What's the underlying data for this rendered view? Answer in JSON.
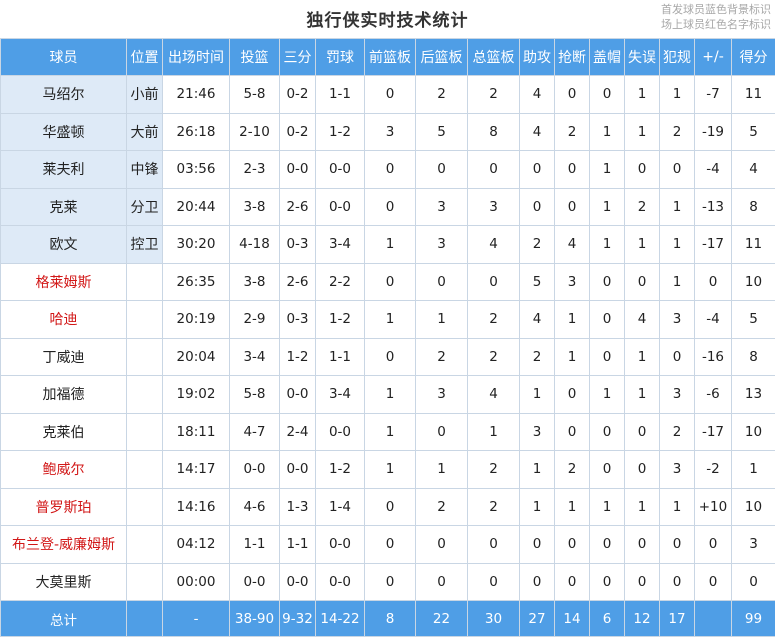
{
  "title": "独行侠实时技术统计",
  "legend": [
    "首发球员蓝色背景标识",
    "场上球员红色名字标识"
  ],
  "colors": {
    "header_bg": "#4f9ee6",
    "starter_bg": "#deeaf7",
    "on_court": "#d21818"
  },
  "headers": [
    "球员",
    "位置",
    "出场时间",
    "投篮",
    "三分",
    "罚球",
    "前篮板",
    "后篮板",
    "总篮板",
    "助攻",
    "抢断",
    "盖帽",
    "失误",
    "犯规",
    "+/-",
    "得分"
  ],
  "players": [
    {
      "name": "马绍尔",
      "pos": "小前",
      "min": "21:46",
      "fg": "5-8",
      "tp": "0-2",
      "ft": "1-1",
      "oreb": "0",
      "dreb": "2",
      "reb": "2",
      "ast": "4",
      "stl": "0",
      "blk": "0",
      "tov": "1",
      "pf": "1",
      "pm": "-7",
      "pts": "11",
      "starter": true,
      "oncourt": false
    },
    {
      "name": "华盛顿",
      "pos": "大前",
      "min": "26:18",
      "fg": "2-10",
      "tp": "0-2",
      "ft": "1-2",
      "oreb": "3",
      "dreb": "5",
      "reb": "8",
      "ast": "4",
      "stl": "2",
      "blk": "1",
      "tov": "1",
      "pf": "2",
      "pm": "-19",
      "pts": "5",
      "starter": true,
      "oncourt": false
    },
    {
      "name": "莱夫利",
      "pos": "中锋",
      "min": "03:56",
      "fg": "2-3",
      "tp": "0-0",
      "ft": "0-0",
      "oreb": "0",
      "dreb": "0",
      "reb": "0",
      "ast": "0",
      "stl": "0",
      "blk": "1",
      "tov": "0",
      "pf": "0",
      "pm": "-4",
      "pts": "4",
      "starter": true,
      "oncourt": false
    },
    {
      "name": "克莱",
      "pos": "分卫",
      "min": "20:44",
      "fg": "3-8",
      "tp": "2-6",
      "ft": "0-0",
      "oreb": "0",
      "dreb": "3",
      "reb": "3",
      "ast": "0",
      "stl": "0",
      "blk": "1",
      "tov": "2",
      "pf": "1",
      "pm": "-13",
      "pts": "8",
      "starter": true,
      "oncourt": false
    },
    {
      "name": "欧文",
      "pos": "控卫",
      "min": "30:20",
      "fg": "4-18",
      "tp": "0-3",
      "ft": "3-4",
      "oreb": "1",
      "dreb": "3",
      "reb": "4",
      "ast": "2",
      "stl": "4",
      "blk": "1",
      "tov": "1",
      "pf": "1",
      "pm": "-17",
      "pts": "11",
      "starter": true,
      "oncourt": false
    },
    {
      "name": "格莱姆斯",
      "pos": "",
      "min": "26:35",
      "fg": "3-8",
      "tp": "2-6",
      "ft": "2-2",
      "oreb": "0",
      "dreb": "0",
      "reb": "0",
      "ast": "5",
      "stl": "3",
      "blk": "0",
      "tov": "0",
      "pf": "1",
      "pm": "0",
      "pts": "10",
      "starter": false,
      "oncourt": true
    },
    {
      "name": "哈迪",
      "pos": "",
      "min": "20:19",
      "fg": "2-9",
      "tp": "0-3",
      "ft": "1-2",
      "oreb": "1",
      "dreb": "1",
      "reb": "2",
      "ast": "4",
      "stl": "1",
      "blk": "0",
      "tov": "4",
      "pf": "3",
      "pm": "-4",
      "pts": "5",
      "starter": false,
      "oncourt": true
    },
    {
      "name": "丁威迪",
      "pos": "",
      "min": "20:04",
      "fg": "3-4",
      "tp": "1-2",
      "ft": "1-1",
      "oreb": "0",
      "dreb": "2",
      "reb": "2",
      "ast": "2",
      "stl": "1",
      "blk": "0",
      "tov": "1",
      "pf": "0",
      "pm": "-16",
      "pts": "8",
      "starter": false,
      "oncourt": false
    },
    {
      "name": "加福德",
      "pos": "",
      "min": "19:02",
      "fg": "5-8",
      "tp": "0-0",
      "ft": "3-4",
      "oreb": "1",
      "dreb": "3",
      "reb": "4",
      "ast": "1",
      "stl": "0",
      "blk": "1",
      "tov": "1",
      "pf": "3",
      "pm": "-6",
      "pts": "13",
      "starter": false,
      "oncourt": false
    },
    {
      "name": "克莱伯",
      "pos": "",
      "min": "18:11",
      "fg": "4-7",
      "tp": "2-4",
      "ft": "0-0",
      "oreb": "1",
      "dreb": "0",
      "reb": "1",
      "ast": "3",
      "stl": "0",
      "blk": "0",
      "tov": "0",
      "pf": "2",
      "pm": "-17",
      "pts": "10",
      "starter": false,
      "oncourt": false
    },
    {
      "name": "鲍威尔",
      "pos": "",
      "min": "14:17",
      "fg": "0-0",
      "tp": "0-0",
      "ft": "1-2",
      "oreb": "1",
      "dreb": "1",
      "reb": "2",
      "ast": "1",
      "stl": "2",
      "blk": "0",
      "tov": "0",
      "pf": "3",
      "pm": "-2",
      "pts": "1",
      "starter": false,
      "oncourt": true
    },
    {
      "name": "普罗斯珀",
      "pos": "",
      "min": "14:16",
      "fg": "4-6",
      "tp": "1-3",
      "ft": "1-4",
      "oreb": "0",
      "dreb": "2",
      "reb": "2",
      "ast": "1",
      "stl": "1",
      "blk": "1",
      "tov": "1",
      "pf": "1",
      "pm": "+10",
      "pts": "10",
      "starter": false,
      "oncourt": true
    },
    {
      "name": "布兰登-威廉姆斯",
      "pos": "",
      "min": "04:12",
      "fg": "1-1",
      "tp": "1-1",
      "ft": "0-0",
      "oreb": "0",
      "dreb": "0",
      "reb": "0",
      "ast": "0",
      "stl": "0",
      "blk": "0",
      "tov": "0",
      "pf": "0",
      "pm": "0",
      "pts": "3",
      "starter": false,
      "oncourt": true
    },
    {
      "name": "大莫里斯",
      "pos": "",
      "min": "00:00",
      "fg": "0-0",
      "tp": "0-0",
      "ft": "0-0",
      "oreb": "0",
      "dreb": "0",
      "reb": "0",
      "ast": "0",
      "stl": "0",
      "blk": "0",
      "tov": "0",
      "pf": "0",
      "pm": "0",
      "pts": "0",
      "starter": false,
      "oncourt": false
    }
  ],
  "totals": {
    "label": "总计",
    "pos": "",
    "min": "-",
    "fg": "38-90",
    "tp": "9-32",
    "ft": "14-22",
    "oreb": "8",
    "dreb": "22",
    "reb": "30",
    "ast": "27",
    "stl": "14",
    "blk": "6",
    "tov": "12",
    "pf": "17",
    "pm": "",
    "pts": "99"
  }
}
